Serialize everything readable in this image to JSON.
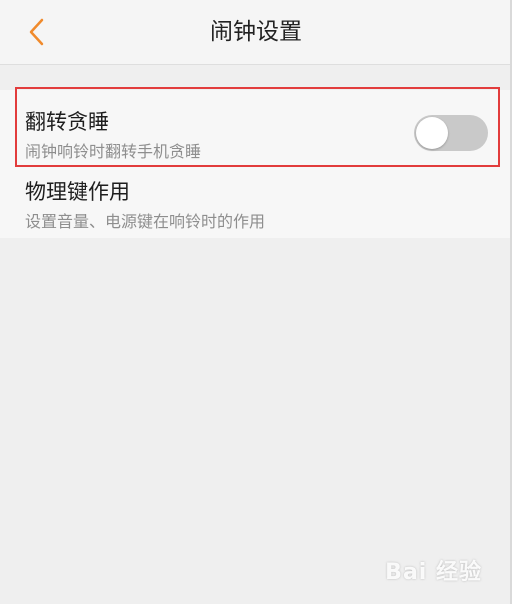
{
  "header": {
    "title": "闹钟设置"
  },
  "settings": {
    "items": [
      {
        "label": "翻转贪睡",
        "description": "闹钟响铃时翻转手机贪睡",
        "toggle": "off"
      },
      {
        "label": "物理键作用",
        "description": "设置音量、电源键在响铃时的作用"
      }
    ]
  },
  "colors": {
    "accent": "#f08a2c",
    "highlight": "#e23c3c",
    "toggle_off": "#c9c9c9"
  },
  "watermark": {
    "text": "Bai 经验"
  }
}
